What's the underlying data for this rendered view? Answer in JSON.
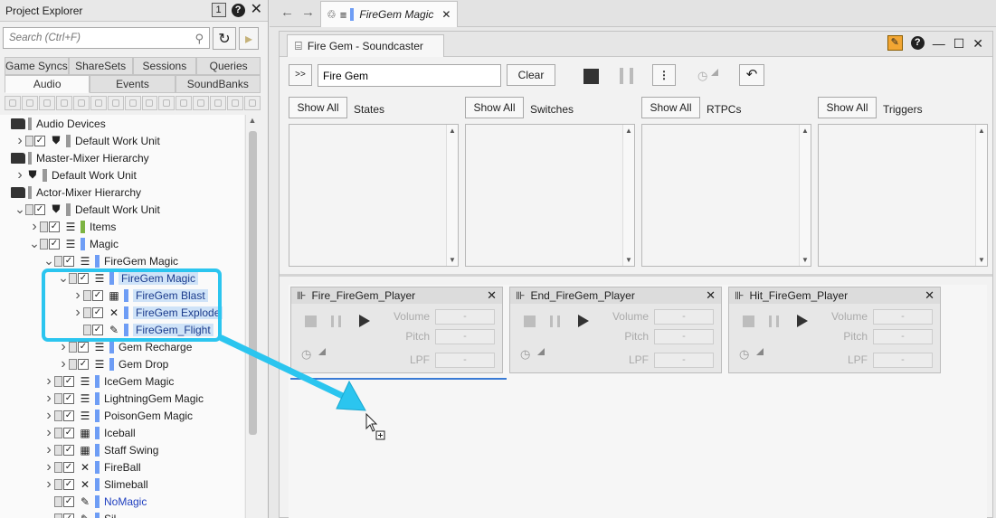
{
  "explorer": {
    "title": "Project Explorer",
    "badge": "1",
    "search_placeholder": "Search (Ctrl+F)",
    "tabs_row1": [
      "Game Syncs",
      "ShareSets",
      "Sessions",
      "Queries"
    ],
    "tabs_row2": [
      "Audio",
      "Events",
      "SoundBanks"
    ],
    "active_tab": "Audio",
    "tree": [
      {
        "label": "Audio Devices",
        "level": 0,
        "type": "folder",
        "chev": ""
      },
      {
        "label": "Default Work Unit",
        "level": 1,
        "type": "workunit",
        "chev": ">",
        "checks": true
      },
      {
        "label": "Master-Mixer Hierarchy",
        "level": 0,
        "type": "folder",
        "chev": ""
      },
      {
        "label": "Default Work Unit",
        "level": 1,
        "type": "workunit",
        "chev": ">",
        "checks": false
      },
      {
        "label": "Actor-Mixer Hierarchy",
        "level": 0,
        "type": "folder",
        "chev": ""
      },
      {
        "label": "Default Work Unit",
        "level": 1,
        "type": "workunit",
        "chev": "v",
        "checks": true
      },
      {
        "label": "Items",
        "level": 2,
        "type": "actor",
        "chev": ">",
        "color": "#7cb342"
      },
      {
        "label": "Magic",
        "level": 2,
        "type": "actor",
        "chev": "v",
        "color": "#6e9df5"
      },
      {
        "label": "FireGem Magic",
        "level": 3,
        "type": "actor",
        "chev": "v",
        "color": "#6e9df5"
      },
      {
        "label": "FireGem Magic",
        "level": 4,
        "type": "actor",
        "chev": "v",
        "color": "#6e9df5",
        "selected": true
      },
      {
        "label": "FireGem Blast",
        "level": 5,
        "type": "random",
        "chev": ">",
        "color": "#6e9df5",
        "selected": true
      },
      {
        "label": "FireGem Explode",
        "level": 5,
        "type": "switch",
        "chev": ">",
        "color": "#6e9df5",
        "selected": true
      },
      {
        "label": "FireGem_Flight",
        "level": 5,
        "type": "sound",
        "chev": "",
        "color": "#6e9df5",
        "selected": true
      },
      {
        "label": "Gem Recharge",
        "level": 4,
        "type": "actor",
        "chev": ">",
        "color": "#6e9df5"
      },
      {
        "label": "Gem Drop",
        "level": 4,
        "type": "sequence",
        "chev": ">",
        "color": "#6e9df5"
      },
      {
        "label": "IceGem Magic",
        "level": 3,
        "type": "actor",
        "chev": ">",
        "color": "#6e9df5"
      },
      {
        "label": "LightningGem Magic",
        "level": 3,
        "type": "actor",
        "chev": ">",
        "color": "#6e9df5"
      },
      {
        "label": "PoisonGem Magic",
        "level": 3,
        "type": "actor",
        "chev": ">",
        "color": "#6e9df5"
      },
      {
        "label": "Iceball",
        "level": 3,
        "type": "random",
        "chev": ">",
        "color": "#6e9df5"
      },
      {
        "label": "Staff Swing",
        "level": 3,
        "type": "random",
        "chev": ">",
        "color": "#6e9df5"
      },
      {
        "label": "FireBall",
        "level": 3,
        "type": "switch",
        "chev": ">",
        "color": "#6e9df5"
      },
      {
        "label": "Slimeball",
        "level": 3,
        "type": "switch",
        "chev": ">",
        "color": "#6e9df5"
      },
      {
        "label": "NoMagic",
        "level": 3,
        "type": "sound",
        "chev": "",
        "color": "#6e9df5",
        "blue": true
      },
      {
        "label": "Sil",
        "level": 3,
        "type": "sound",
        "chev": "",
        "color": "#6e9df5"
      }
    ]
  },
  "doc_tab": {
    "title": "FireGem Magic"
  },
  "soundcaster": {
    "tab_title": "Fire Gem - Soundcaster",
    "expand_label": ">>",
    "filter_value": "Fire Gem",
    "clear_label": "Clear",
    "show_all_label": "Show All",
    "lists": [
      "States",
      "Switches",
      "RTPCs",
      "Triggers"
    ],
    "players": [
      {
        "name": "Fire_FireGem_Player"
      },
      {
        "name": "End_FireGem_Player"
      },
      {
        "name": "Hit_FireGem_Player"
      }
    ],
    "param_labels": [
      "Volume",
      "Pitch",
      "LPF"
    ],
    "param_value": "-"
  }
}
